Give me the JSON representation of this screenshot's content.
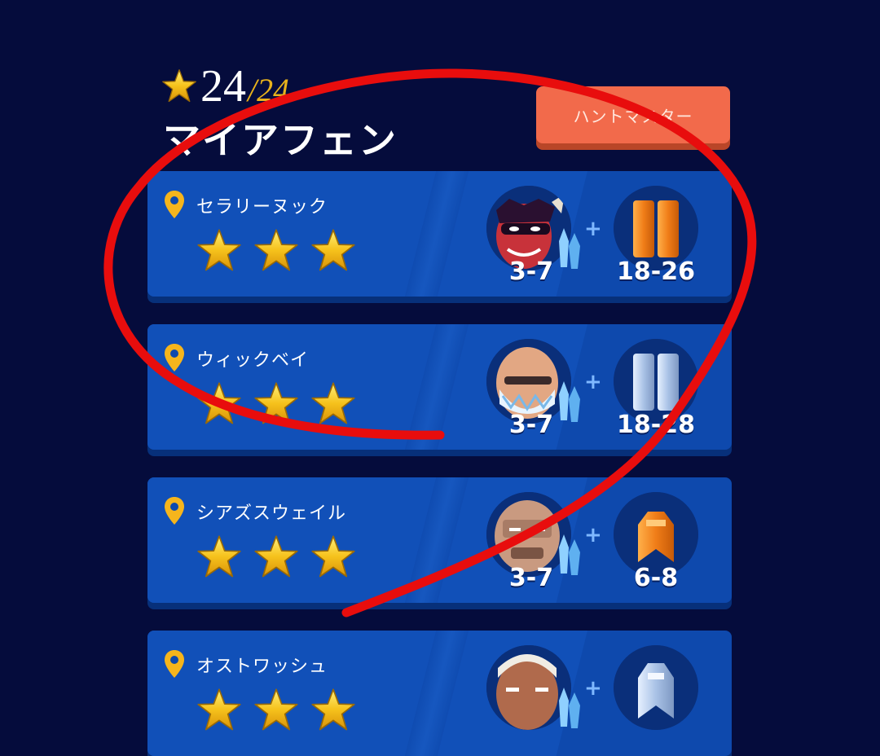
{
  "header": {
    "score_current": "24",
    "score_separator": "/",
    "score_total": "24",
    "region_name": "マイアフェン",
    "hunt_button_label": "ハントマスター"
  },
  "locations": [
    {
      "name": "セラリーヌック",
      "stars": 3,
      "monster_range": "3-7",
      "reward_range": "18-26",
      "reward_icon": "orange-ingot-pair-icon",
      "monster_icon": "red-horned-monster-icon"
    },
    {
      "name": "ウィックベイ",
      "stars": 3,
      "monster_range": "3-7",
      "reward_range": "18-28",
      "reward_icon": "silver-ingot-pair-icon",
      "monster_icon": "bald-bearded-monster-icon"
    },
    {
      "name": "シアズスウェイル",
      "stars": 3,
      "monster_range": "3-7",
      "reward_range": "6-8",
      "reward_icon": "orange-ingot-stack-icon",
      "monster_icon": "rock-golem-monster-icon"
    },
    {
      "name": "オストワッシュ",
      "stars": 3,
      "monster_range": "",
      "reward_range": "",
      "reward_icon": "silver-ingot-stack-icon",
      "monster_icon": "white-haired-warrior-icon"
    }
  ],
  "colors": {
    "background": "#050c3c",
    "card": "#0e49ad",
    "star": "#f6c21c",
    "hunt_button": "#f26a4b",
    "annotation": "#e80d0d"
  }
}
